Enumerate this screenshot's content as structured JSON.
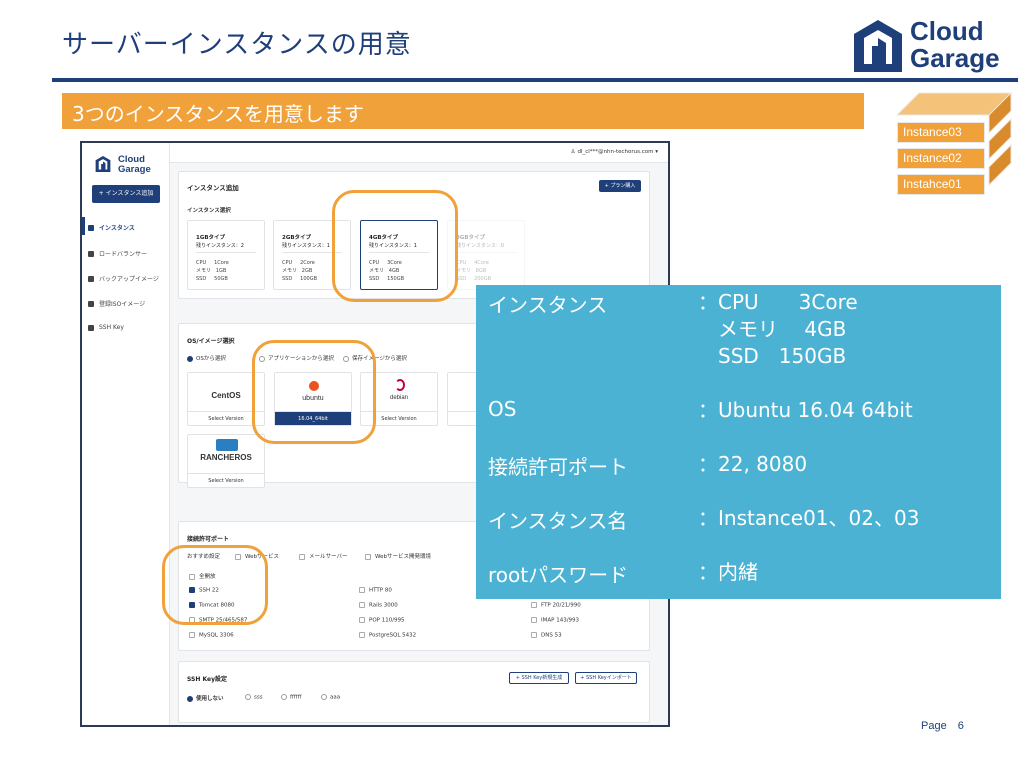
{
  "slide": {
    "title": "サーバーインスタンスの用意",
    "subtitle": "3つのインスタンスを用意します",
    "page": "Page　6"
  },
  "logo": {
    "line1": "Cloud",
    "line2": "Garage"
  },
  "instances": [
    "Instance03",
    "Instance02",
    "Instahce01"
  ],
  "app": {
    "logo": {
      "line1": "Cloud",
      "line2": "Garage"
    },
    "add_button": "+ インスタンス追加",
    "user": "dl_cl***@nhn-techorus.com",
    "nav": [
      {
        "label": "インスタンス",
        "active": true
      },
      {
        "label": "ロードバランサー",
        "active": false
      },
      {
        "label": "バックアップイメージ",
        "active": false
      },
      {
        "label": "登録ISOイメージ",
        "active": false
      },
      {
        "label": "SSH Key",
        "active": false
      }
    ],
    "section_title": "インスタンス追加",
    "plan_button": "+ プラン購入",
    "type_select_label": "インスタンス選択",
    "types": [
      {
        "name": "1GBタイプ",
        "remain": "残りインスタンス：2",
        "specs": "CPU     1Core\nメモリ   1GB\nSSD     50GB"
      },
      {
        "name": "2GBタイプ",
        "remain": "残りインスタンス：1",
        "specs": "CPU     2Core\nメモリ   2GB\nSSD     100GB"
      },
      {
        "name": "4GBタイプ",
        "remain": "残りインスタンス：1",
        "specs": "CPU     3Core\nメモリ   4GB\nSSD     150GB"
      },
      {
        "name": "8GBタイプ",
        "remain": "残りインスタンス：0",
        "specs": "CPU     4Core\nメモリ   8GB\nSSD     200GB"
      }
    ],
    "os_section_label": "OS/イメージ選択",
    "os_tabs": [
      "OSから選択",
      "アプリケーションから選択",
      "保存イメージから選択"
    ],
    "os_list": [
      {
        "name": "CentOS",
        "version": "Select Version"
      },
      {
        "name": "ubuntu",
        "version": "16.04_64bit"
      },
      {
        "name": "debian",
        "version": "Select Version"
      },
      {
        "name": "",
        "version": ""
      },
      {
        "name": "RANCHEROS",
        "version": "Select Version"
      }
    ],
    "port_section_label": "接続許可ポート",
    "port_presets": [
      "おすすめ設定",
      "Webサービス",
      "メールサーバー",
      "Webサービス開発環境"
    ],
    "ports_col1": [
      {
        "label": "全開放",
        "on": false
      },
      {
        "label": "SSH     22",
        "on": true
      },
      {
        "label": "Tomcat   8080",
        "on": true
      },
      {
        "label": "SMTP   25/465/587",
        "on": false
      },
      {
        "label": "MySQL   3306",
        "on": false
      }
    ],
    "ports_col2": [
      "HTTP   80",
      "Rails   3000",
      "POP   110/995",
      "PostgreSQL   5432"
    ],
    "ports_col3": [
      "FTP   20/21/990",
      "IMAP   143/993",
      "DNS   53"
    ],
    "ssh_section_label": "SSH Key設定",
    "ssh_new": "+ SSH Key新規生成",
    "ssh_import": "+ SSH Keyインポート",
    "ssh_options": [
      "使用しない",
      "sss",
      "ffffff",
      "aaa"
    ]
  },
  "info": {
    "rows": [
      {
        "key": "インスタンス",
        "value": "：CPU　　3Core\n　メモリ　 4GB\n　SSD　150GB"
      },
      {
        "key": "OS",
        "value": "：Ubuntu 16.04 64bit"
      },
      {
        "key": "接続許可ポート",
        "value": "：22, 8080"
      },
      {
        "key": "インスタンス名",
        "value": "：Instance01、02、03"
      },
      {
        "key": "rootパスワード",
        "value": "：内緒"
      }
    ]
  },
  "colors": {
    "brand": "#1f3f7a",
    "accent": "#f0a13a",
    "info_bg": "#4bb2d3"
  }
}
